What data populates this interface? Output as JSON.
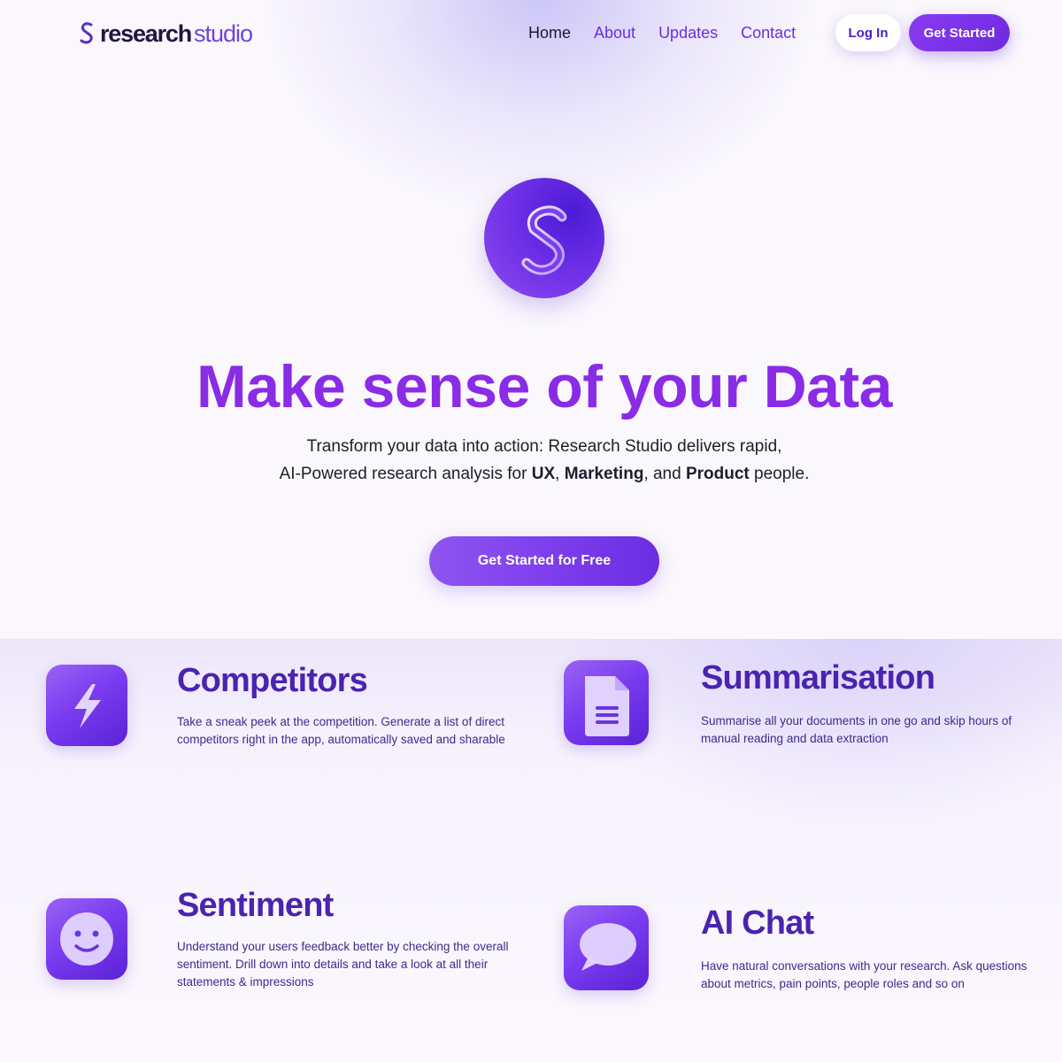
{
  "brand": {
    "name_bold": "research",
    "name_light": "studio"
  },
  "nav": {
    "items": [
      {
        "label": "Home",
        "active": true
      },
      {
        "label": "About",
        "active": false
      },
      {
        "label": "Updates",
        "active": false
      },
      {
        "label": "Contact",
        "active": false
      }
    ],
    "login_label": "Log In",
    "get_started_label": "Get Started"
  },
  "hero": {
    "title": "Make sense of your Data",
    "subtitle_line1": "Transform your data into action: Research Studio delivers rapid,",
    "subtitle_line2_prefix": "AI-Powered research analysis for ",
    "subtitle_bold_1": "UX",
    "subtitle_sep_1": ", ",
    "subtitle_bold_2": "Marketing",
    "subtitle_sep_2": ", and ",
    "subtitle_bold_3": "Product",
    "subtitle_suffix": " people.",
    "cta_label": "Get Started for Free"
  },
  "features": [
    {
      "icon": "lightning-icon",
      "title": "Competitors",
      "desc_line1": "Take a sneak peek at the competition. Generate a list of direct",
      "desc_line2": "competitors right in the app, automatically saved  and sharable"
    },
    {
      "icon": "document-icon",
      "title": "Summarisation",
      "desc_line1": "Summarise all your documents in one go and skip hours of",
      "desc_line2": "manual reading and data extraction"
    },
    {
      "icon": "smiley-icon",
      "title": "Sentiment",
      "desc_line1": "Understand your users feedback better by checking the overall",
      "desc_line2": "sentiment. Drill down into details and take a look at all their",
      "desc_line3": "statements & impressions"
    },
    {
      "icon": "chat-bubble-icon",
      "title": "AI Chat",
      "desc_line1": "Have natural conversations with your research. Ask questions",
      "desc_line2": "about metrics, pain points, people roles and so on"
    }
  ],
  "colors": {
    "accent": "#8a2be6",
    "primary_button": "#7a35ea",
    "feature_title": "#4a23b0",
    "background": "#faf7fd"
  }
}
